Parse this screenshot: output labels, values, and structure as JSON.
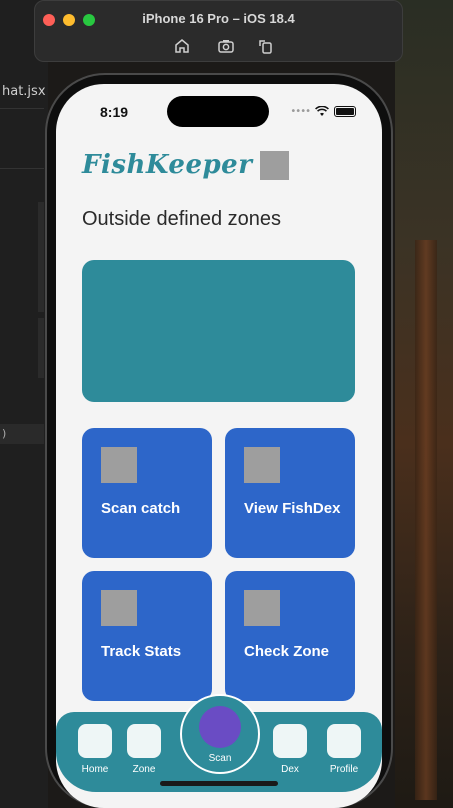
{
  "desktop": {
    "editor_tab": "hat.jsx",
    "editor_strip": ")"
  },
  "simulator": {
    "title": "iPhone 16 Pro – iOS 18.4",
    "tools": [
      "home-icon",
      "screenshot-icon",
      "rotate-icon"
    ]
  },
  "status_bar": {
    "time": "8:19",
    "dots": "••••"
  },
  "app": {
    "logo_text": "FishKeeper",
    "zone_heading": "Outside defined zones",
    "tiles": [
      {
        "label": "Scan catch"
      },
      {
        "label": "View FishDex"
      },
      {
        "label": "Track Stats"
      },
      {
        "label": "Check Zone"
      }
    ],
    "tabs": [
      {
        "label": "Home"
      },
      {
        "label": "Zone"
      },
      {
        "label": "Scan"
      },
      {
        "label": "Dex"
      },
      {
        "label": "Profile"
      }
    ]
  },
  "colors": {
    "brand_teal": "#2e8b9a",
    "tile_blue": "#2d66c9",
    "scan_purple": "#6a4cc4",
    "placeholder_gray": "#9e9e9e"
  }
}
